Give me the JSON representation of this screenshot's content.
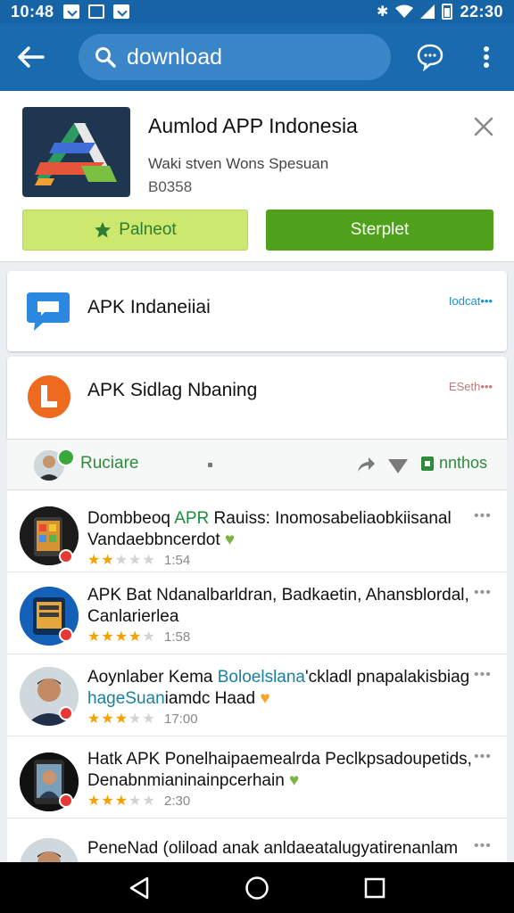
{
  "status_bar": {
    "time": "10:48",
    "clock": "22:30"
  },
  "app_bar": {
    "search_query": "download"
  },
  "ad": {
    "title": "Aumlod APP Indonesia",
    "subtitle": "Waki stven Wons Spesuan",
    "price": "B0358",
    "secondary_label": "Palneot",
    "primary_label": "Sterplet"
  },
  "results": [
    {
      "title": "APK Indaneiiai",
      "action": "Iodcat•••"
    },
    {
      "title": "APK Sidlag Nbaning",
      "action": "ESeth•••"
    }
  ],
  "feed_header": {
    "name": "Ruciare",
    "tag": "nnthos"
  },
  "posts": [
    {
      "lead": "Dombbeoq ",
      "highlight": "APR",
      "rest": " Rauiss: Inomosabeliaobkiisanal Vandaebbncerdot",
      "emoji": "♥",
      "rating": 2,
      "time": "1:54"
    },
    {
      "lead": "APK Bat Ndanalbarldran, Badkaetin, Ahansblordal, Canlarierlea",
      "highlight": "",
      "rest": "",
      "emoji": "",
      "rating": 4,
      "time": "1:58"
    },
    {
      "lead": "Aoynlaber Kema ",
      "highlight": "Boloelslana",
      "rest": "'ckladl pnapalakisbiag ",
      "highlight2": "hageSuan",
      "rest2": "iamdc Haad",
      "emoji": "♥",
      "rating": 3,
      "time": "17:00"
    },
    {
      "lead": "Hatk APK Ponelhaipaemealrda Peclkpsadoupetids, Denabnmianinainpcerhain",
      "highlight": "",
      "rest": "",
      "emoji": "♥",
      "rating": 3,
      "time": "2:30"
    },
    {
      "lead": "PeneNad (oliload anak anldaeatalugyatirenanlam",
      "highlight": "",
      "rest": "",
      "emoji": "",
      "rating": 0,
      "time": ""
    }
  ],
  "colors": {
    "app_bar": "#1a6ab0",
    "status_bar": "#1664a6",
    "primary_button": "#4fa01a",
    "secondary_button": "#cde86e"
  }
}
